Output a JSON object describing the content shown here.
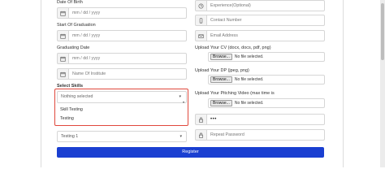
{
  "form": {
    "date_of_birth": {
      "label": "Date Of Birth",
      "placeholder": "mm / dd / yyyy"
    },
    "start_of_graduation": {
      "label": "Start Of Graduation",
      "placeholder": "mm / dd / yyyy"
    },
    "graduating_date": {
      "label": "Graduating Date",
      "placeholder": "mm / dd / yyyy"
    },
    "institute": {
      "placeholder": "Name Of Institute"
    },
    "experience": {
      "placeholder": "Experience(Optional)"
    },
    "contact_number": {
      "placeholder": "Contact Number"
    },
    "email": {
      "placeholder": "Email Address"
    },
    "cv_upload": {
      "label": "Upload Your CV (docx, docs, pdf, png)",
      "button": "Browse...",
      "status": "No file selected."
    },
    "dp_upload": {
      "label": "Upload Your DP (jpeg, png)",
      "button": "Browse...",
      "status": "No file selected."
    },
    "video_upload": {
      "label": "Upload Your Pitching Video (max time is",
      "button": "Browse...",
      "status": "No file selected."
    },
    "password": {
      "value": "•••"
    },
    "repeat_password": {
      "placeholder": "Repeat Password"
    },
    "skills": {
      "label": "Select Skills",
      "selected_text": "Nothing selected",
      "options": [
        "Skill Testing",
        "Testing"
      ]
    },
    "second_select": {
      "value": "Testing 1"
    },
    "register_label": "Register"
  },
  "icons": {
    "calendar": "calendar-icon",
    "clock": "clock-icon",
    "phone": "phone-icon",
    "email": "envelope-icon",
    "lock": "lock-icon"
  },
  "colors": {
    "accent": "#1a3fd1",
    "highlight_border": "#e0483c"
  }
}
